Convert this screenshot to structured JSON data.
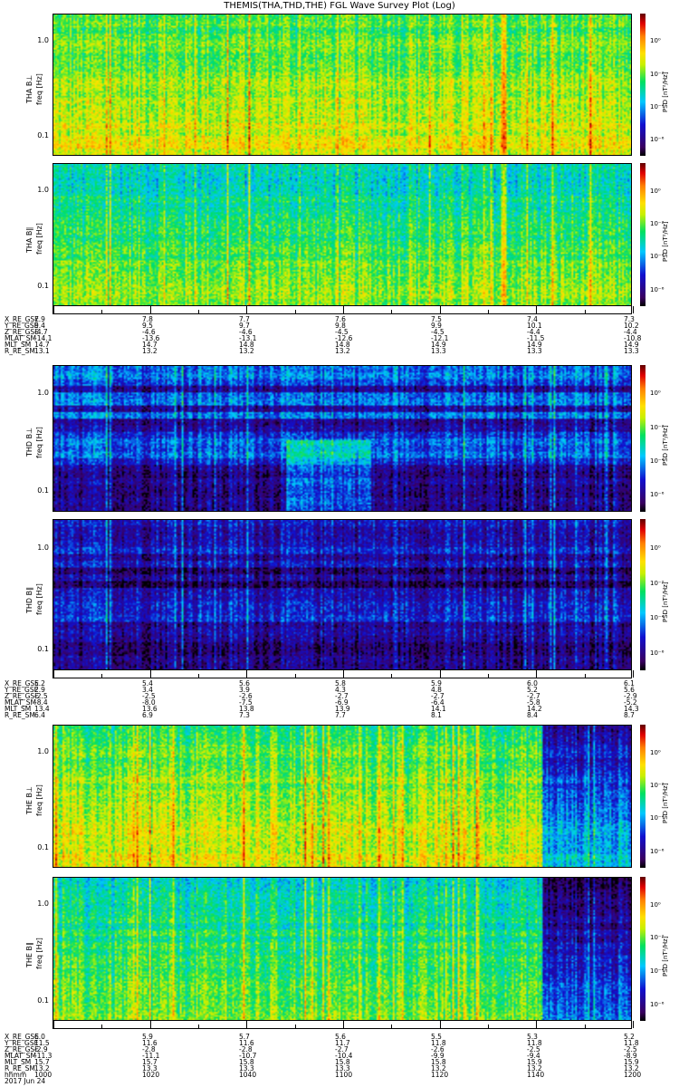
{
  "title": "THEMIS(THA,THD,THE) FGL Wave Survey Plot (Log)",
  "colorbar": {
    "unit": "PSD [nT²/Hz]",
    "ticks": [
      "10⁰",
      "10⁻²",
      "10⁻⁴",
      "10⁻⁶"
    ]
  },
  "chart_data": {
    "type": "heatmap",
    "panels": [
      {
        "probe": "THA",
        "label": "THA B⊥",
        "ylabel": "freq [Hz]",
        "yticks": [
          "1.0",
          "0.1"
        ],
        "ylim": [
          0.062,
          1.93
        ],
        "mean_log_psd": -1.6,
        "high_freq_drop": 1.2
      },
      {
        "probe": "THA",
        "label": "THA B∥",
        "ylabel": "freq [Hz]",
        "yticks": [
          "1.0",
          "0.1"
        ],
        "ylim": [
          0.062,
          1.93
        ],
        "mean_log_psd": -2.3,
        "high_freq_drop": 1.5
      },
      {
        "probe": "THD",
        "label": "THD B⊥",
        "ylabel": "freq [Hz]",
        "yticks": [
          "1.0",
          "0.1"
        ],
        "ylim": [
          0.062,
          1.93
        ],
        "mean_log_psd": -4.8,
        "high_freq_drop": -0.5
      },
      {
        "probe": "THD",
        "label": "THD B∥",
        "ylabel": "freq [Hz]",
        "yticks": [
          "1.0",
          "0.1"
        ],
        "ylim": [
          0.062,
          1.93
        ],
        "mean_log_psd": -5.3,
        "high_freq_drop": -0.3
      },
      {
        "probe": "THE",
        "label": "THE B⊥",
        "ylabel": "freq [Hz]",
        "yticks": [
          "1.0",
          "0.1"
        ],
        "ylim": [
          0.062,
          1.93
        ],
        "mean_log_psd": -1.6,
        "high_freq_drop": 1.3
      },
      {
        "probe": "THE",
        "label": "THE B∥",
        "ylabel": "freq [Hz]",
        "yticks": [
          "1.0",
          "0.1"
        ],
        "ylim": [
          0.062,
          1.93
        ],
        "mean_log_psd": -2.4,
        "high_freq_drop": 1.5
      }
    ],
    "colorbar_range_log": [
      -6.5,
      1.5
    ],
    "x_time_labels": [
      "1000",
      "1020",
      "1040",
      "1100",
      "1120",
      "1140",
      "1200"
    ],
    "x_label": "hhmm",
    "date": "2017 Jun 24"
  },
  "ephemeris": [
    {
      "probe": "THA",
      "rows": [
        {
          "name": "X_RE_GSE",
          "values": [
            "7.9",
            "7.8",
            "7.7",
            "7.6",
            "7.5",
            "7.4",
            "7.3"
          ]
        },
        {
          "name": "Y_RE_GSE",
          "values": [
            "9.4",
            "9.5",
            "9.7",
            "9.8",
            "9.9",
            "10.1",
            "10.2"
          ]
        },
        {
          "name": "Z_RE_GSE",
          "values": [
            "-4.7",
            "-4.6",
            "-4.6",
            "-4.5",
            "-4.5",
            "-4.4",
            "-4.4"
          ]
        },
        {
          "name": "MLAT_SM",
          "values": [
            "-14.1",
            "-13.6",
            "-13.1",
            "-12.6",
            "-12.1",
            "-11.5",
            "-10.8"
          ]
        },
        {
          "name": "MLT_SM",
          "values": [
            "14.7",
            "14.7",
            "14.8",
            "14.8",
            "14.9",
            "14.9",
            "14.9"
          ]
        },
        {
          "name": "R_RE_SM",
          "values": [
            "13.1",
            "13.2",
            "13.2",
            "13.2",
            "13.3",
            "13.3",
            "13.3"
          ]
        }
      ]
    },
    {
      "probe": "THD",
      "rows": [
        {
          "name": "X_RE_GSE",
          "values": [
            "5.2",
            "5.4",
            "5.6",
            "5.8",
            "5.9",
            "6.0",
            "6.1"
          ]
        },
        {
          "name": "Y_RE_GSE",
          "values": [
            "2.9",
            "3.4",
            "3.9",
            "4.3",
            "4.8",
            "5.2",
            "5.6"
          ]
        },
        {
          "name": "Z_RE_GSE",
          "values": [
            "-2.5",
            "-2.5",
            "-2.6",
            "-2.7",
            "-2.7",
            "-2.7",
            "-2.9"
          ]
        },
        {
          "name": "MLAT_SM",
          "values": [
            "-8.4",
            "-8.0",
            "-7.5",
            "-6.9",
            "-6.4",
            "-5.8",
            "-5.2"
          ]
        },
        {
          "name": "MLT_SM",
          "values": [
            "13.4",
            "13.6",
            "13.8",
            "13.9",
            "14.1",
            "14.2",
            "14.3"
          ]
        },
        {
          "name": "R_RE_SM",
          "values": [
            "6.4",
            "6.9",
            "7.3",
            "7.7",
            "8.1",
            "8.4",
            "8.7"
          ]
        }
      ]
    },
    {
      "probe": "THE",
      "rows": [
        {
          "name": "X_RE_GSE",
          "values": [
            "6.0",
            "5.9",
            "5.7",
            "5.6",
            "5.5",
            "5.3",
            "5.2"
          ]
        },
        {
          "name": "Y_RE_GSE",
          "values": [
            "11.5",
            "11.6",
            "11.6",
            "11.7",
            "11.8",
            "11.8",
            "11.8"
          ]
        },
        {
          "name": "Z_RE_GSE",
          "values": [
            "-2.9",
            "-2.8",
            "-2.8",
            "-2.7",
            "-2.6",
            "-2.5",
            "-2.5"
          ]
        },
        {
          "name": "MLAT_SM",
          "values": [
            "-11.3",
            "-11.1",
            "-10.7",
            "-10.4",
            "-9.9",
            "-9.4",
            "-8.9"
          ]
        },
        {
          "name": "MLT_SM",
          "values": [
            "15.7",
            "15.7",
            "15.8",
            "15.8",
            "15.8",
            "15.9",
            "15.9"
          ]
        },
        {
          "name": "R_RE_SM",
          "values": [
            "13.2",
            "13.3",
            "13.3",
            "13.3",
            "13.2",
            "13.2",
            "13.2"
          ]
        },
        {
          "name": "hhmm",
          "values": [
            "1000",
            "1020",
            "1040",
            "1100",
            "1120",
            "1140",
            "1200"
          ]
        }
      ],
      "date": "2017 Jun 24"
    }
  ]
}
